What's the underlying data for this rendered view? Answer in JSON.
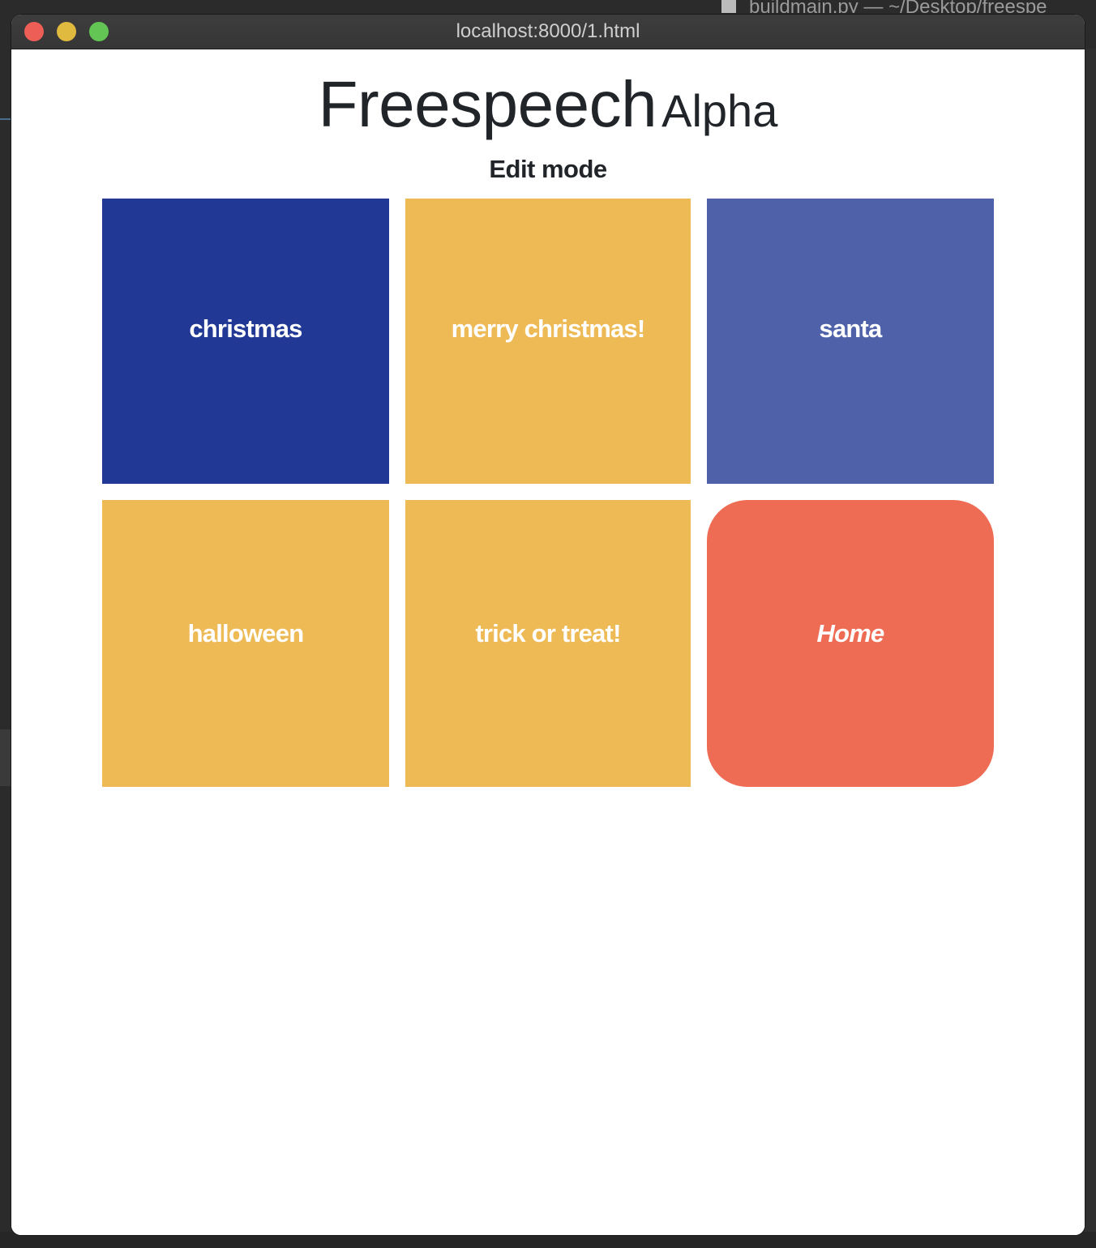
{
  "background_window": {
    "title_fragment": "buildmain.py — ~/Desktop/freespe"
  },
  "window": {
    "title": "localhost:8000/1.html"
  },
  "page": {
    "title": "Freespeech",
    "subtitle": "Alpha",
    "mode_label": "Edit mode"
  },
  "tiles": [
    {
      "label": "christmas",
      "color": "#213894"
    },
    {
      "label": "merry christmas!",
      "color": "#edba56"
    },
    {
      "label": "santa",
      "color": "#4e61a9"
    },
    {
      "label": "halloween",
      "color": "#edba56"
    },
    {
      "label": "trick or treat!",
      "color": "#edba56"
    },
    {
      "label": "Home",
      "color": "#ef6c54"
    }
  ],
  "traffic_lights": {
    "close_color": "#ed5f56",
    "minimize_color": "#e0b93f",
    "maximize_color": "#62c554"
  }
}
